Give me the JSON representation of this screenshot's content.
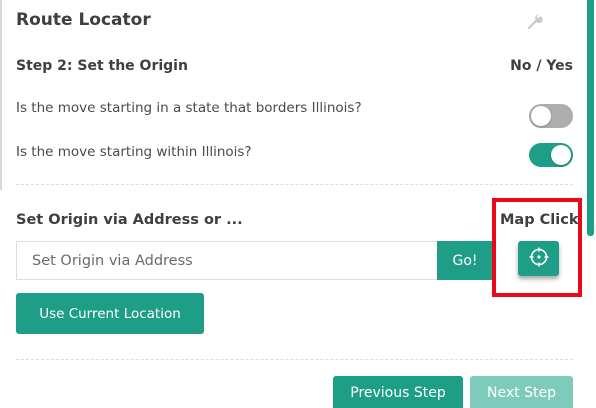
{
  "header": {
    "title": "Route Locator",
    "settings_icon": "wrench-icon"
  },
  "step": {
    "title": "Step 2: Set the Origin",
    "answer_header": "No / Yes"
  },
  "questions": [
    {
      "label": "Is the move starting in a state that borders Illinois?",
      "value": "No"
    },
    {
      "label": "Is the move starting within Illinois?",
      "value": "Yes"
    }
  ],
  "origin": {
    "label": "Set Origin via Address or ...",
    "map_click_label": "Map Click",
    "address_placeholder": "Set Origin via Address",
    "address_value": "",
    "go_label": "Go!",
    "map_click_icon": "crosshair-icon",
    "use_location_label": "Use Current Location"
  },
  "navigation": {
    "previous_label": "Previous Step",
    "next_label": "Next Step"
  },
  "colors": {
    "accent": "#1e9e86",
    "accent_disabled": "#7ecbbc",
    "toggle_off": "#adadad",
    "highlight": "#e8091a"
  }
}
